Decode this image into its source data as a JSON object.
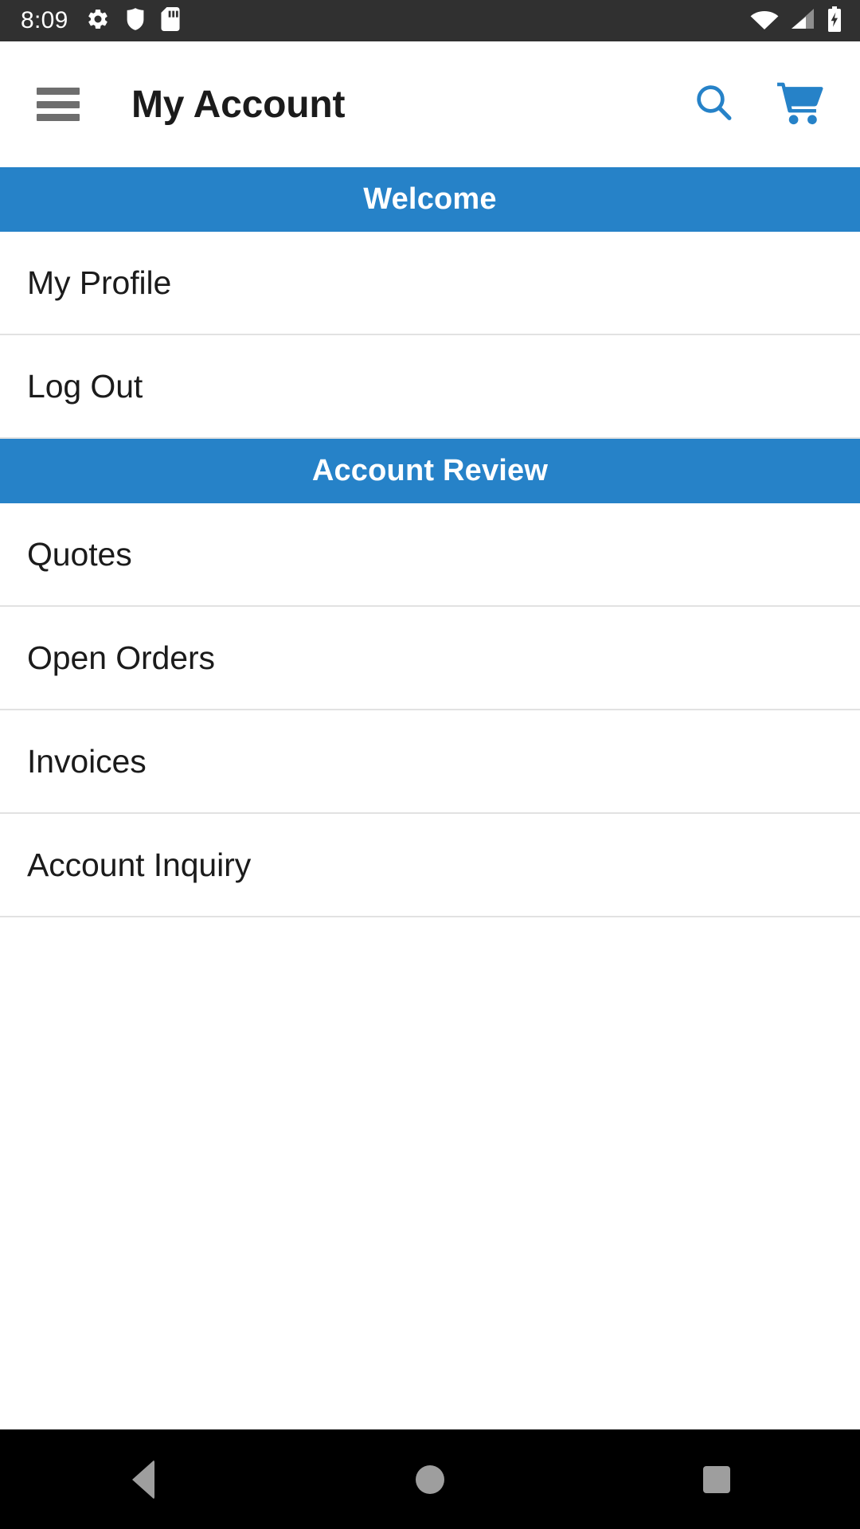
{
  "status_bar": {
    "time": "8:09",
    "left_icons": [
      "gear-icon",
      "shield-icon",
      "sd-card-icon"
    ],
    "right_icons": [
      "wifi-icon",
      "cell-signal-icon",
      "battery-charging-icon"
    ],
    "background_color": "#303030"
  },
  "app_bar": {
    "menu_icon": "hamburger-menu-icon",
    "title": "My Account",
    "actions": [
      {
        "icon": "search-icon",
        "color": "#2682c8"
      },
      {
        "icon": "shopping-cart-icon",
        "color": "#2682c8"
      }
    ]
  },
  "accent_color": "#2682c8",
  "sections": [
    {
      "header": "Welcome",
      "items": [
        {
          "label": "My Profile"
        },
        {
          "label": "Log Out"
        }
      ]
    },
    {
      "header": "Account Review",
      "items": [
        {
          "label": "Quotes"
        },
        {
          "label": "Open Orders"
        },
        {
          "label": "Invoices"
        },
        {
          "label": "Account Inquiry"
        }
      ]
    }
  ],
  "nav_bar": {
    "buttons": [
      {
        "icon": "back-triangle-icon"
      },
      {
        "icon": "home-circle-icon"
      },
      {
        "icon": "recents-square-icon"
      }
    ],
    "background_color": "#000000"
  }
}
